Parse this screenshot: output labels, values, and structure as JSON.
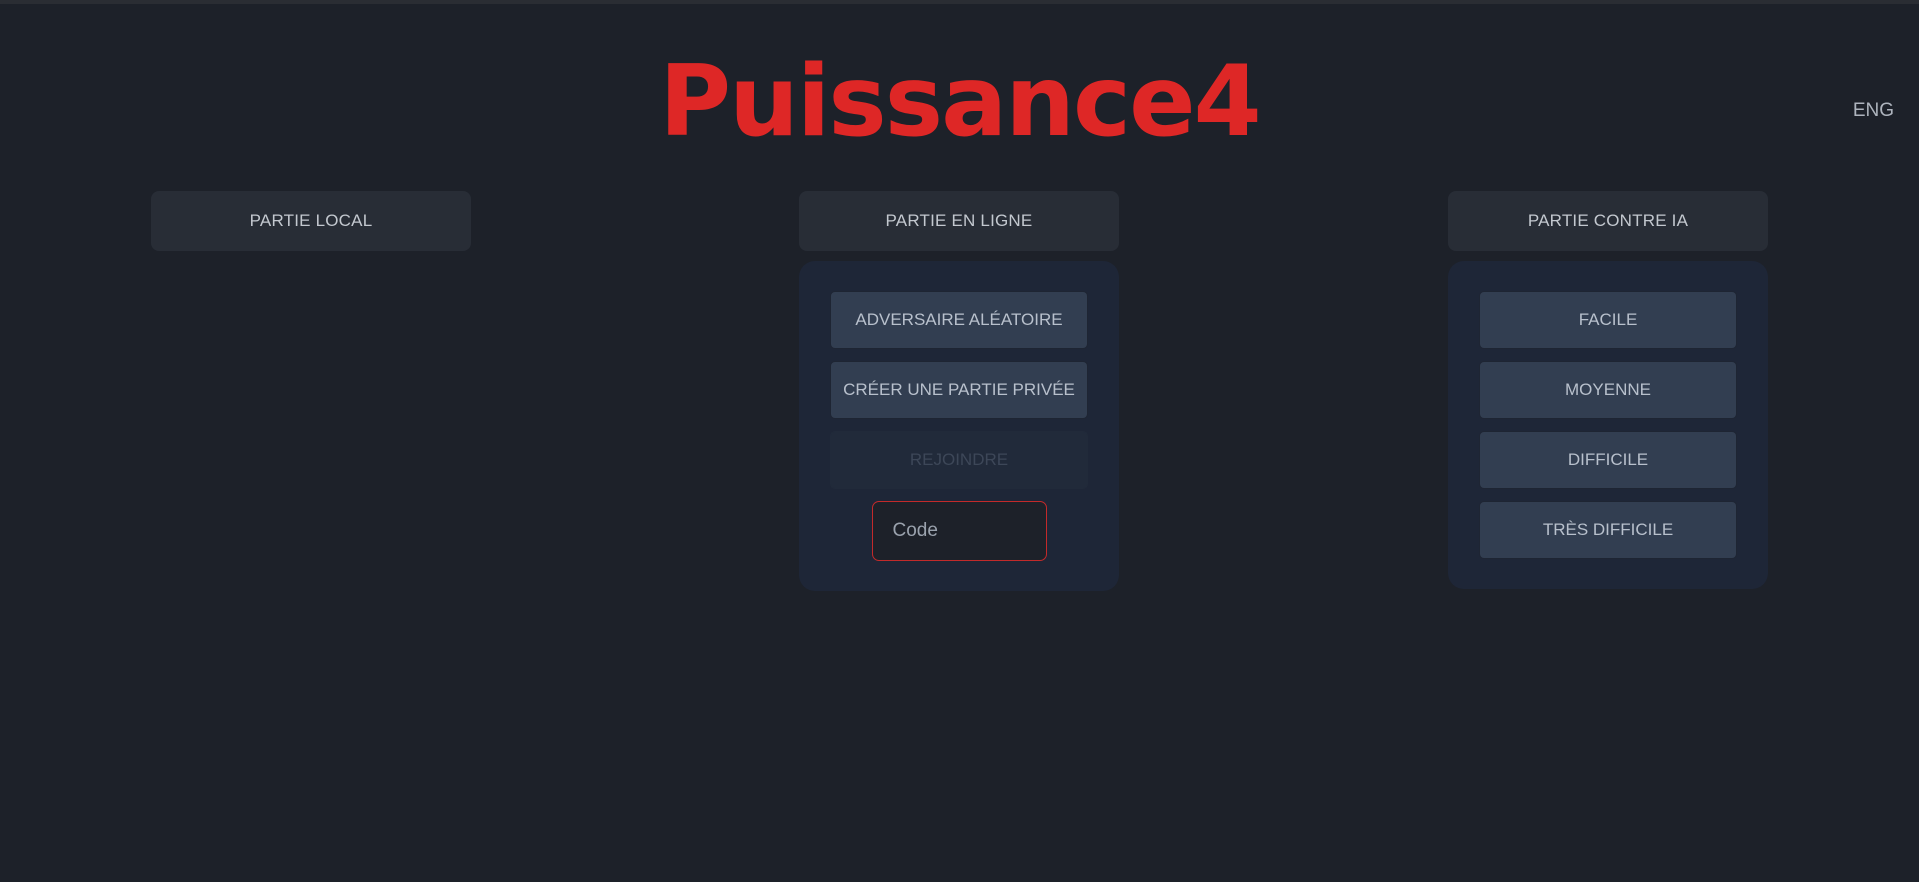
{
  "app": {
    "title": "Puissance4",
    "language": "ENG"
  },
  "modes": {
    "local": {
      "label": "PARTIE LOCAL"
    },
    "online": {
      "label": "PARTIE EN LIGNE",
      "random_opponent": "ADVERSAIRE ALÉATOIRE",
      "create_private": "CRÉER UNE PARTIE PRIVÉE",
      "join": "REJOINDRE",
      "join_disabled": true,
      "code_placeholder": "Code",
      "code_value": ""
    },
    "ai": {
      "label": "PARTIE CONTRE IA",
      "difficulties": [
        "FACILE",
        "MOYENNE",
        "DIFFICILE",
        "TRÈS DIFFICILE"
      ]
    }
  },
  "colors": {
    "background": "#1d2129",
    "title": "#de2726",
    "input_border": "#c32a2a"
  }
}
